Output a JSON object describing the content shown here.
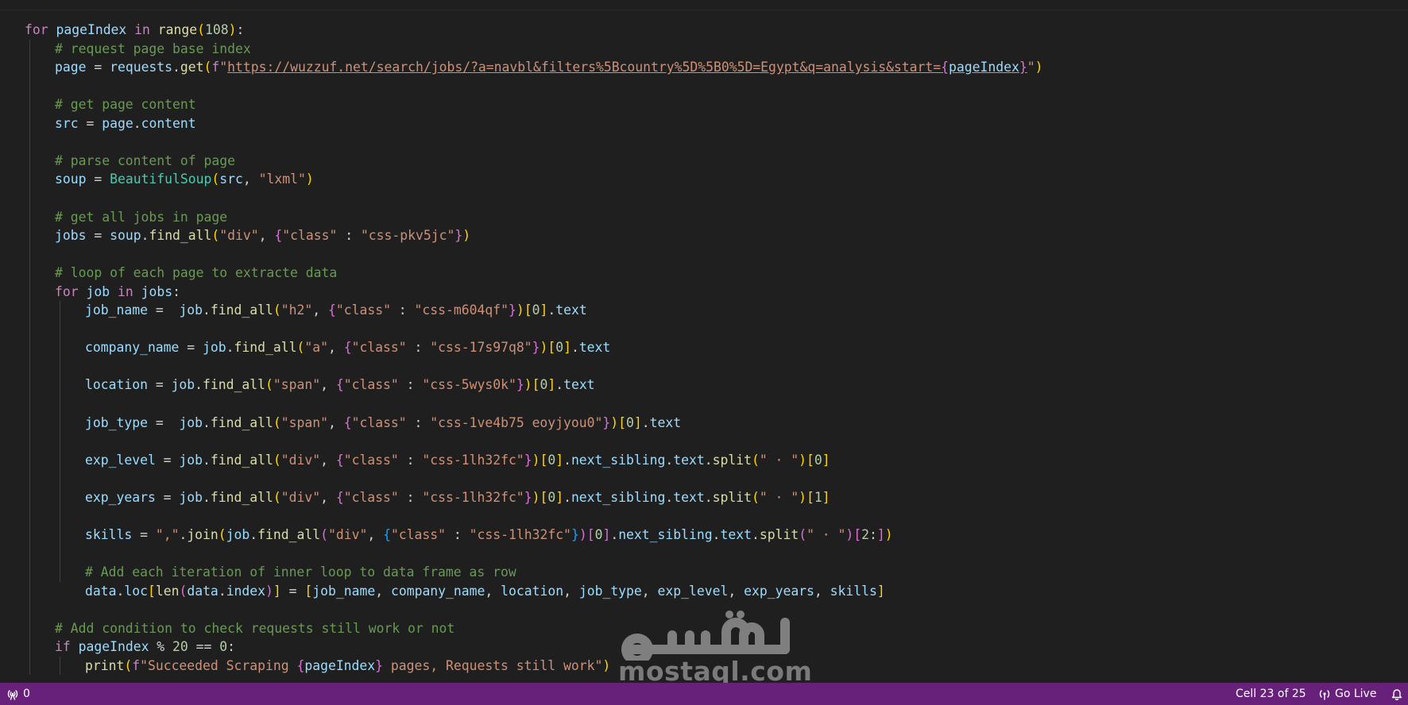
{
  "code_lines": [
    {
      "indent": 0,
      "tokens": [
        [
          "kw",
          "for"
        ],
        [
          "op",
          " "
        ],
        [
          "v",
          "pageIndex"
        ],
        [
          "op",
          " "
        ],
        [
          "kw",
          "in"
        ],
        [
          "op",
          " "
        ],
        [
          "fn",
          "range"
        ],
        [
          "b1",
          "("
        ],
        [
          "nm",
          "108"
        ],
        [
          "b1",
          ")"
        ],
        [
          "op",
          ":"
        ]
      ]
    },
    {
      "indent": 1,
      "tokens": [
        [
          "cm",
          "# request page base index"
        ]
      ]
    },
    {
      "indent": 1,
      "tokens": [
        [
          "v",
          "page"
        ],
        [
          "op",
          " = "
        ],
        [
          "v",
          "requests"
        ],
        [
          "op",
          "."
        ],
        [
          "fn",
          "get"
        ],
        [
          "b1",
          "("
        ],
        [
          "kw",
          "f"
        ],
        [
          "st",
          "\""
        ],
        [
          "st url",
          "https://wuzzuf.net/search/jobs/?a=navbl&filters%5Bcountry%5D%5B0%5D=Egypt&q=analysis&start="
        ],
        [
          "b2 url",
          "{"
        ],
        [
          "ivar url",
          "pageIndex"
        ],
        [
          "b2 url",
          "}"
        ],
        [
          "st",
          "\""
        ],
        [
          "b1",
          ")"
        ]
      ]
    },
    {
      "indent": 1,
      "tokens": []
    },
    {
      "indent": 1,
      "tokens": [
        [
          "cm",
          "# get page content"
        ]
      ]
    },
    {
      "indent": 1,
      "tokens": [
        [
          "v",
          "src"
        ],
        [
          "op",
          " = "
        ],
        [
          "v",
          "page"
        ],
        [
          "op",
          "."
        ],
        [
          "v",
          "content"
        ]
      ]
    },
    {
      "indent": 1,
      "tokens": []
    },
    {
      "indent": 1,
      "tokens": [
        [
          "cm",
          "# parse content of page"
        ]
      ]
    },
    {
      "indent": 1,
      "tokens": [
        [
          "v",
          "soup"
        ],
        [
          "op",
          " = "
        ],
        [
          "cls",
          "BeautifulSoup"
        ],
        [
          "b1",
          "("
        ],
        [
          "v",
          "src"
        ],
        [
          "op",
          ", "
        ],
        [
          "st",
          "\"lxml\""
        ],
        [
          "b1",
          ")"
        ]
      ]
    },
    {
      "indent": 1,
      "tokens": []
    },
    {
      "indent": 1,
      "tokens": [
        [
          "cm",
          "# get all jobs in page"
        ]
      ]
    },
    {
      "indent": 1,
      "tokens": [
        [
          "v",
          "jobs"
        ],
        [
          "op",
          " = "
        ],
        [
          "v",
          "soup"
        ],
        [
          "op",
          "."
        ],
        [
          "fn",
          "find_all"
        ],
        [
          "b1",
          "("
        ],
        [
          "st",
          "\"div\""
        ],
        [
          "op",
          ", "
        ],
        [
          "b2",
          "{"
        ],
        [
          "st",
          "\"class\""
        ],
        [
          "op",
          " : "
        ],
        [
          "st",
          "\"css-pkv5jc\""
        ],
        [
          "b2",
          "}"
        ],
        [
          "b1",
          ")"
        ]
      ]
    },
    {
      "indent": 1,
      "tokens": []
    },
    {
      "indent": 1,
      "tokens": [
        [
          "cm",
          "# loop of each page to extracte data"
        ]
      ]
    },
    {
      "indent": 1,
      "tokens": [
        [
          "kw",
          "for"
        ],
        [
          "op",
          " "
        ],
        [
          "v",
          "job"
        ],
        [
          "op",
          " "
        ],
        [
          "kw",
          "in"
        ],
        [
          "op",
          " "
        ],
        [
          "v",
          "jobs"
        ],
        [
          "op",
          ":"
        ]
      ]
    },
    {
      "indent": 2,
      "tokens": [
        [
          "v",
          "job_name"
        ],
        [
          "op",
          " =  "
        ],
        [
          "v",
          "job"
        ],
        [
          "op",
          "."
        ],
        [
          "fn",
          "find_all"
        ],
        [
          "b1",
          "("
        ],
        [
          "st",
          "\"h2\""
        ],
        [
          "op",
          ", "
        ],
        [
          "b2",
          "{"
        ],
        [
          "st",
          "\"class\""
        ],
        [
          "op",
          " : "
        ],
        [
          "st",
          "\"css-m604qf\""
        ],
        [
          "b2",
          "}"
        ],
        [
          "b1",
          ")"
        ],
        [
          "b1",
          "["
        ],
        [
          "nm",
          "0"
        ],
        [
          "b1",
          "]"
        ],
        [
          "op",
          "."
        ],
        [
          "v",
          "text"
        ]
      ]
    },
    {
      "indent": 2,
      "tokens": []
    },
    {
      "indent": 2,
      "tokens": [
        [
          "v",
          "company_name"
        ],
        [
          "op",
          " = "
        ],
        [
          "v",
          "job"
        ],
        [
          "op",
          "."
        ],
        [
          "fn",
          "find_all"
        ],
        [
          "b1",
          "("
        ],
        [
          "st",
          "\"a\""
        ],
        [
          "op",
          ", "
        ],
        [
          "b2",
          "{"
        ],
        [
          "st",
          "\"class\""
        ],
        [
          "op",
          " : "
        ],
        [
          "st",
          "\"css-17s97q8\""
        ],
        [
          "b2",
          "}"
        ],
        [
          "b1",
          ")"
        ],
        [
          "b1",
          "["
        ],
        [
          "nm",
          "0"
        ],
        [
          "b1",
          "]"
        ],
        [
          "op",
          "."
        ],
        [
          "v",
          "text"
        ]
      ]
    },
    {
      "indent": 2,
      "tokens": []
    },
    {
      "indent": 2,
      "tokens": [
        [
          "v",
          "location"
        ],
        [
          "op",
          " = "
        ],
        [
          "v",
          "job"
        ],
        [
          "op",
          "."
        ],
        [
          "fn",
          "find_all"
        ],
        [
          "b1",
          "("
        ],
        [
          "st",
          "\"span\""
        ],
        [
          "op",
          ", "
        ],
        [
          "b2",
          "{"
        ],
        [
          "st",
          "\"class\""
        ],
        [
          "op",
          " : "
        ],
        [
          "st",
          "\"css-5wys0k\""
        ],
        [
          "b2",
          "}"
        ],
        [
          "b1",
          ")"
        ],
        [
          "b1",
          "["
        ],
        [
          "nm",
          "0"
        ],
        [
          "b1",
          "]"
        ],
        [
          "op",
          "."
        ],
        [
          "v",
          "text"
        ]
      ]
    },
    {
      "indent": 2,
      "tokens": []
    },
    {
      "indent": 2,
      "tokens": [
        [
          "v",
          "job_type"
        ],
        [
          "op",
          " =  "
        ],
        [
          "v",
          "job"
        ],
        [
          "op",
          "."
        ],
        [
          "fn",
          "find_all"
        ],
        [
          "b1",
          "("
        ],
        [
          "st",
          "\"span\""
        ],
        [
          "op",
          ", "
        ],
        [
          "b2",
          "{"
        ],
        [
          "st",
          "\"class\""
        ],
        [
          "op",
          " : "
        ],
        [
          "st",
          "\"css-1ve4b75 eoyjyou0\""
        ],
        [
          "b2",
          "}"
        ],
        [
          "b1",
          ")"
        ],
        [
          "b1",
          "["
        ],
        [
          "nm",
          "0"
        ],
        [
          "b1",
          "]"
        ],
        [
          "op",
          "."
        ],
        [
          "v",
          "text"
        ]
      ]
    },
    {
      "indent": 2,
      "tokens": []
    },
    {
      "indent": 2,
      "tokens": [
        [
          "v",
          "exp_level"
        ],
        [
          "op",
          " = "
        ],
        [
          "v",
          "job"
        ],
        [
          "op",
          "."
        ],
        [
          "fn",
          "find_all"
        ],
        [
          "b1",
          "("
        ],
        [
          "st",
          "\"div\""
        ],
        [
          "op",
          ", "
        ],
        [
          "b2",
          "{"
        ],
        [
          "st",
          "\"class\""
        ],
        [
          "op",
          " : "
        ],
        [
          "st",
          "\"css-1lh32fc\""
        ],
        [
          "b2",
          "}"
        ],
        [
          "b1",
          ")"
        ],
        [
          "b1",
          "["
        ],
        [
          "nm",
          "0"
        ],
        [
          "b1",
          "]"
        ],
        [
          "op",
          "."
        ],
        [
          "v",
          "next_sibling"
        ],
        [
          "op",
          "."
        ],
        [
          "v",
          "text"
        ],
        [
          "op",
          "."
        ],
        [
          "fn",
          "split"
        ],
        [
          "b1",
          "("
        ],
        [
          "st",
          "\" · \""
        ],
        [
          "b1",
          ")"
        ],
        [
          "b1",
          "["
        ],
        [
          "nm",
          "0"
        ],
        [
          "b1",
          "]"
        ]
      ]
    },
    {
      "indent": 2,
      "tokens": []
    },
    {
      "indent": 2,
      "tokens": [
        [
          "v",
          "exp_years"
        ],
        [
          "op",
          " = "
        ],
        [
          "v",
          "job"
        ],
        [
          "op",
          "."
        ],
        [
          "fn",
          "find_all"
        ],
        [
          "b1",
          "("
        ],
        [
          "st",
          "\"div\""
        ],
        [
          "op",
          ", "
        ],
        [
          "b2",
          "{"
        ],
        [
          "st",
          "\"class\""
        ],
        [
          "op",
          " : "
        ],
        [
          "st",
          "\"css-1lh32fc\""
        ],
        [
          "b2",
          "}"
        ],
        [
          "b1",
          ")"
        ],
        [
          "b1",
          "["
        ],
        [
          "nm",
          "0"
        ],
        [
          "b1",
          "]"
        ],
        [
          "op",
          "."
        ],
        [
          "v",
          "next_sibling"
        ],
        [
          "op",
          "."
        ],
        [
          "v",
          "text"
        ],
        [
          "op",
          "."
        ],
        [
          "fn",
          "split"
        ],
        [
          "b1",
          "("
        ],
        [
          "st",
          "\" · \""
        ],
        [
          "b1",
          ")"
        ],
        [
          "b1",
          "["
        ],
        [
          "nm",
          "1"
        ],
        [
          "b1",
          "]"
        ]
      ]
    },
    {
      "indent": 2,
      "tokens": []
    },
    {
      "indent": 2,
      "tokens": [
        [
          "v",
          "skills"
        ],
        [
          "op",
          " = "
        ],
        [
          "st",
          "\",\""
        ],
        [
          "op",
          "."
        ],
        [
          "fn",
          "join"
        ],
        [
          "b1",
          "("
        ],
        [
          "v",
          "job"
        ],
        [
          "op",
          "."
        ],
        [
          "fn",
          "find_all"
        ],
        [
          "b2",
          "("
        ],
        [
          "st",
          "\"div\""
        ],
        [
          "op",
          ", "
        ],
        [
          "b3",
          "{"
        ],
        [
          "st",
          "\"class\""
        ],
        [
          "op",
          " : "
        ],
        [
          "st",
          "\"css-1lh32fc\""
        ],
        [
          "b3",
          "}"
        ],
        [
          "b2",
          ")"
        ],
        [
          "b2",
          "["
        ],
        [
          "nm",
          "0"
        ],
        [
          "b2",
          "]"
        ],
        [
          "op",
          "."
        ],
        [
          "v",
          "next_sibling"
        ],
        [
          "op",
          "."
        ],
        [
          "v",
          "text"
        ],
        [
          "op",
          "."
        ],
        [
          "fn",
          "split"
        ],
        [
          "b2",
          "("
        ],
        [
          "st",
          "\" · \""
        ],
        [
          "b2",
          ")"
        ],
        [
          "b2",
          "["
        ],
        [
          "nm",
          "2"
        ],
        [
          "op",
          ":"
        ],
        [
          "b2",
          "]"
        ],
        [
          "b1",
          ")"
        ]
      ]
    },
    {
      "indent": 2,
      "tokens": []
    },
    {
      "indent": 2,
      "tokens": [
        [
          "cm",
          "# Add each iteration of inner loop to data frame as row"
        ]
      ]
    },
    {
      "indent": 2,
      "tokens": [
        [
          "v",
          "data"
        ],
        [
          "op",
          "."
        ],
        [
          "v",
          "loc"
        ],
        [
          "b1",
          "["
        ],
        [
          "fn",
          "len"
        ],
        [
          "b2",
          "("
        ],
        [
          "v",
          "data"
        ],
        [
          "op",
          "."
        ],
        [
          "v",
          "index"
        ],
        [
          "b2",
          ")"
        ],
        [
          "b1",
          "]"
        ],
        [
          "op",
          " = "
        ],
        [
          "b1",
          "["
        ],
        [
          "v",
          "job_name"
        ],
        [
          "op",
          ", "
        ],
        [
          "v",
          "company_name"
        ],
        [
          "op",
          ", "
        ],
        [
          "v",
          "location"
        ],
        [
          "op",
          ", "
        ],
        [
          "v",
          "job_type"
        ],
        [
          "op",
          ", "
        ],
        [
          "v",
          "exp_level"
        ],
        [
          "op",
          ", "
        ],
        [
          "v",
          "exp_years"
        ],
        [
          "op",
          ", "
        ],
        [
          "v",
          "skills"
        ],
        [
          "b1",
          "]"
        ]
      ]
    },
    {
      "indent": 1,
      "tokens": []
    },
    {
      "indent": 1,
      "tokens": [
        [
          "cm",
          "# Add condition to check requests still work or not"
        ]
      ]
    },
    {
      "indent": 1,
      "tokens": [
        [
          "kw",
          "if"
        ],
        [
          "op",
          " "
        ],
        [
          "v",
          "pageIndex"
        ],
        [
          "op",
          " % "
        ],
        [
          "nm",
          "20"
        ],
        [
          "op",
          " == "
        ],
        [
          "nm",
          "0"
        ],
        [
          "op",
          ":"
        ]
      ]
    },
    {
      "indent": 2,
      "tokens": [
        [
          "fn",
          "print"
        ],
        [
          "b1",
          "("
        ],
        [
          "kw",
          "f"
        ],
        [
          "st",
          "\"Succeeded Scraping "
        ],
        [
          "b2",
          "{"
        ],
        [
          "v",
          "pageIndex"
        ],
        [
          "b2",
          "}"
        ],
        [
          "st",
          " pages, Requests still work\""
        ],
        [
          "b1",
          ")"
        ]
      ]
    }
  ],
  "watermark": {
    "arabic_text": "مستقل",
    "latin_text": "mostaql.com"
  },
  "statusbar": {
    "background": "#68217a",
    "remote_icon": "broadcast-icon",
    "problems_count": "0",
    "cell_position": "Cell 23 of 25",
    "go_live_icon": "broadcast-icon",
    "go_live_label": "Go Live",
    "bell_icon": "bell-icon"
  }
}
